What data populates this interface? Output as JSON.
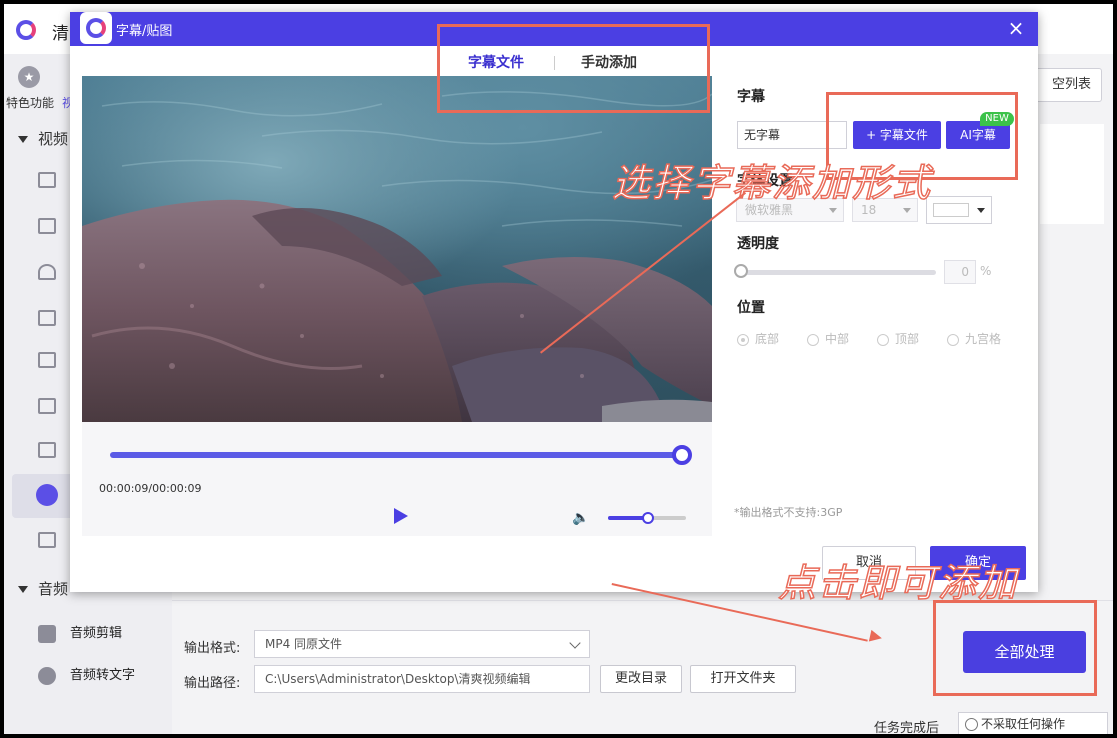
{
  "app": {
    "title": "清",
    "sidebar": {
      "feature_label": "特色功能",
      "feature_label_link": "视",
      "video_section": "视频",
      "audio_section": "音频",
      "audio_items": [
        "音频剪辑",
        "音频转文字"
      ]
    },
    "clear_list_label": "空列表",
    "output": {
      "format_label": "输出格式:",
      "format_value": "MP4  同原文件",
      "path_label": "输出路径:",
      "path_value": "C:\\Users\\Administrator\\Desktop\\清爽视频编辑",
      "change_dir": "更改目录",
      "open_folder": "打开文件夹",
      "process_all": "全部处理"
    },
    "task": {
      "label": "任务完成后",
      "value": "不采取任何操作"
    }
  },
  "modal": {
    "title": "字幕/贴图",
    "close_glyph": "×",
    "tabs": [
      {
        "label": "字幕文件",
        "active": true
      },
      {
        "label": "手动添加",
        "active": false
      }
    ],
    "player": {
      "time": "00:00:09/00:00:09",
      "progress": 1.0,
      "volume": 0.5,
      "volume_glyph": "🔈"
    },
    "settings": {
      "subtitle_label": "字幕",
      "subtitle_value": "无字幕",
      "subtitle_file_btn": "+ 字幕文件",
      "ai_btn": "AI字幕",
      "new_badge": "NEW",
      "font_label": "字体设置",
      "font_family": "微软雅黑",
      "font_size": "18",
      "opacity_label": "透明度",
      "opacity_value": "0",
      "opacity_unit": "%",
      "position_label": "位置",
      "positions": [
        "底部",
        "中部",
        "顶部",
        "九宫格"
      ],
      "note": "*输出格式不支持:3GP"
    },
    "cancel": "取消",
    "confirm": "确定"
  },
  "annotations": {
    "choose_text": "选择字幕添加形式",
    "click_text": "点击即可添加",
    "color": "#e96a58"
  }
}
